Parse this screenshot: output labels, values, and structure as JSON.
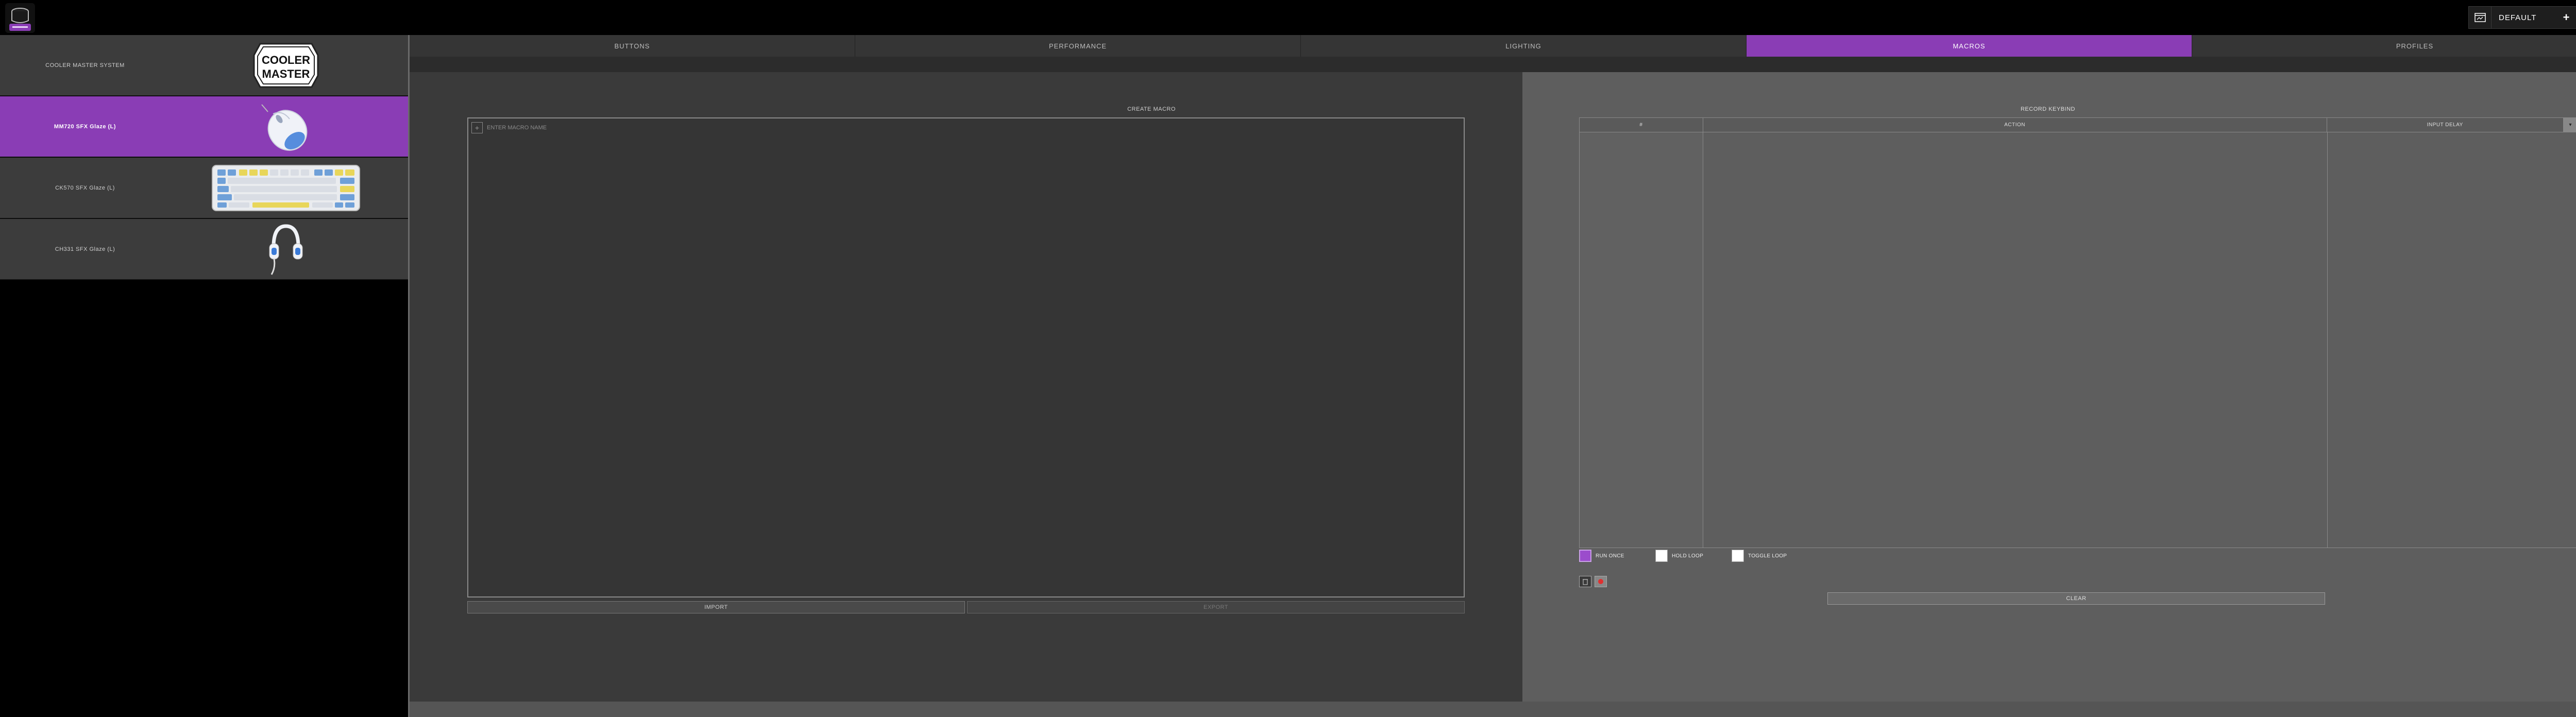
{
  "header": {
    "app_logo_icon": "cooler-master-app-icon",
    "profile_icon": "profile-window-icon",
    "profile_name": "DEFAULT",
    "add_symbol": "+",
    "caret_symbol": "▾",
    "win_minimize": "–",
    "win_restore": "❐",
    "win_close": "✕",
    "collapse_symbol": "⤡"
  },
  "sidebar": {
    "items": [
      {
        "label": "COOLER MASTER SYSTEM",
        "icon": "cooler-master-logo"
      },
      {
        "label": "MM720 SFX Glaze (L)",
        "icon": "mouse-image"
      },
      {
        "label": "CK570 SFX Glaze (L)",
        "icon": "keyboard-image"
      },
      {
        "label": "CH331 SFX Glaze (L)",
        "icon": "headset-image"
      }
    ],
    "logo_text_top": "COOLER",
    "logo_text_bottom": "MASTER",
    "active_color": "#8a3db5"
  },
  "tabs": [
    {
      "label": "BUTTONS"
    },
    {
      "label": "PERFORMANCE"
    },
    {
      "label": "LIGHTING"
    },
    {
      "label": "MACROS",
      "active": true
    },
    {
      "label": "PROFILES"
    }
  ],
  "macros": {
    "create_label": "CREATE MACRO",
    "add_symbol": "+",
    "name_placeholder": "ENTER MACRO NAME",
    "import_label": "IMPORT",
    "export_label": "EXPORT"
  },
  "record": {
    "title": "RECORD KEYBIND",
    "columns": {
      "num": "#",
      "action": "ACTION",
      "delay": "INPUT DELAY"
    },
    "dropdown_symbol": "▾",
    "options": [
      {
        "label": "RUN ONCE",
        "checked": true
      },
      {
        "label": "HOLD LOOP",
        "checked": false
      },
      {
        "label": "TOGGLE LOOP",
        "checked": false
      }
    ],
    "clear_label": "CLEAR"
  }
}
